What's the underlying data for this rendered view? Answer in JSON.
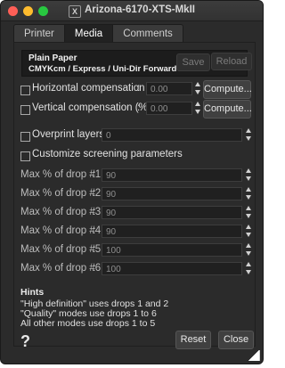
{
  "window": {
    "title": "Arizona-6170-XTS-MkII",
    "app_icon": "X"
  },
  "tabs": [
    {
      "label": "Printer",
      "active": false
    },
    {
      "label": "Media",
      "active": true
    },
    {
      "label": "Comments",
      "active": false
    }
  ],
  "media": {
    "name": "Plain Paper",
    "mode": "CMYKcm / Express / Uni-Dir Forward",
    "save_label": "Save",
    "reload_label": "Reload"
  },
  "horizontal": {
    "label": "Horizontal compensation (%)",
    "colon": ":",
    "value": "0.00",
    "checked": false,
    "compute_label": "Compute..."
  },
  "vertical": {
    "label": "Vertical compensation (%)",
    "colon": ":",
    "value": "0.00",
    "checked": false,
    "compute_label": "Compute..."
  },
  "overprint": {
    "label": "Overprint layers",
    "colon": ":",
    "value": "0",
    "checked": false
  },
  "screening": {
    "label": "Customize screening parameters",
    "checked": false
  },
  "drops": [
    {
      "label": "Max % of drop #1",
      "value": "90"
    },
    {
      "label": "Max % of drop #2",
      "value": "90"
    },
    {
      "label": "Max % of drop #3",
      "value": "90"
    },
    {
      "label": "Max % of drop #4",
      "value": "90"
    },
    {
      "label": "Max % of drop #5",
      "value": "100"
    },
    {
      "label": "Max % of drop #6",
      "value": "100"
    }
  ],
  "hints": {
    "title": "Hints",
    "lines": [
      "\"High definition\" uses drops 1 and 2",
      "\"Quality\" modes use drops 1 to 6",
      "All other modes use drops 1 to 5"
    ]
  },
  "footer": {
    "help_label": "?",
    "reset_label": "Reset",
    "close_label": "Close"
  },
  "colors": {
    "window_bg": "#2b2b2b",
    "close": "#fe5f57",
    "minimize": "#febc2e",
    "zoom": "#28c840"
  }
}
